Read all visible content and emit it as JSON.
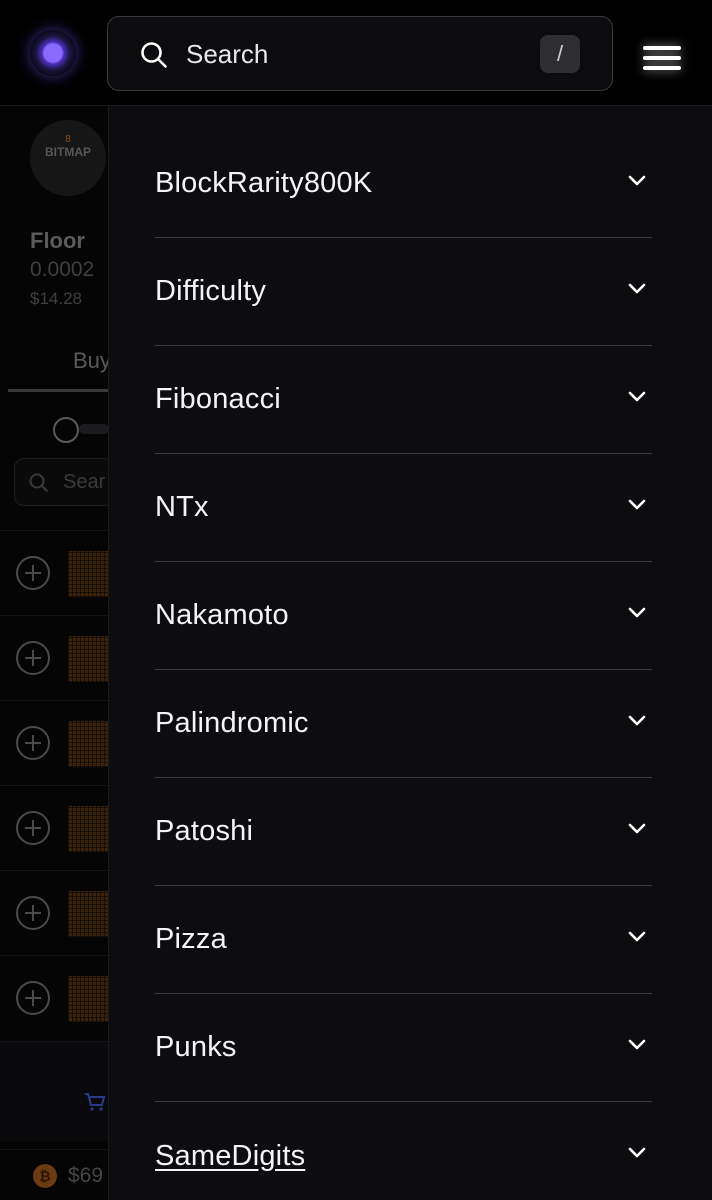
{
  "header": {
    "logo_icon": "purple-orb-logo-icon",
    "search": {
      "placeholder": "Search",
      "shortcut": "/"
    },
    "menu_icon": "hamburger-menu-icon"
  },
  "background": {
    "collection_avatar": {
      "top": "8",
      "name": "BITMAP"
    },
    "floor": {
      "label": "Floor",
      "value": "0.0002",
      "usd": "$14.28"
    },
    "buy_tab": "Buy",
    "search_placeholder": "Sear",
    "rows_count_visible": 6,
    "btc_price": "$69"
  },
  "menu": {
    "items": [
      {
        "label": "BlockRarity800K"
      },
      {
        "label": "Difficulty"
      },
      {
        "label": "Fibonacci"
      },
      {
        "label": "NTx"
      },
      {
        "label": "Nakamoto"
      },
      {
        "label": "Palindromic"
      },
      {
        "label": "Patoshi"
      },
      {
        "label": "Pizza"
      },
      {
        "label": "Punks"
      },
      {
        "label": "SameDigits"
      }
    ]
  },
  "colors": {
    "accent": "#7b5cff",
    "background": "#000000",
    "drawer": "#0d0d0f",
    "divider": "#3a3a3d"
  }
}
